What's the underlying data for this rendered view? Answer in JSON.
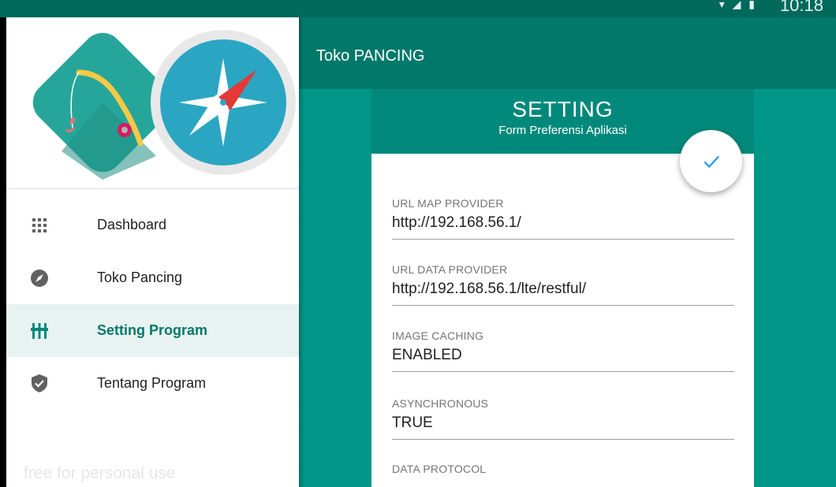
{
  "status_bar": {
    "clock": "10:18",
    "icons": [
      "wifi-icon",
      "signal-icon",
      "battery-icon"
    ]
  },
  "app_bar": {
    "title": "Toko PANCING"
  },
  "drawer": {
    "logo": "fishing-rod-compass-logo",
    "items": [
      {
        "label": "Dashboard",
        "icon": "grid-icon",
        "active": false
      },
      {
        "label": "Toko Pancing",
        "icon": "compass-icon",
        "active": false
      },
      {
        "label": "Setting Program",
        "icon": "equalizer-icon",
        "active": true
      },
      {
        "label": "Tentang Program",
        "icon": "shield-check-icon",
        "active": false
      }
    ],
    "watermark": "free for personal use"
  },
  "form": {
    "title": "SETTING",
    "subtitle": "Form Preferensi Aplikasi",
    "fields": [
      {
        "label": "URL MAP PROVIDER",
        "value": "http://192.168.56.1/"
      },
      {
        "label": "URL DATA PROVIDER",
        "value": "http://192.168.56.1/lte/restful/"
      },
      {
        "label": "IMAGE CACHING",
        "value": "ENABLED"
      },
      {
        "label": "ASYNCHRONOUS",
        "value": "TRUE"
      },
      {
        "label": "DATA PROTOCOL",
        "value": ""
      }
    ],
    "save_icon": "check-icon"
  },
  "colors": {
    "primary": "#009688",
    "primary_dark": "#00796b",
    "header": "#00897b",
    "active_bg": "#e8f3f1"
  }
}
